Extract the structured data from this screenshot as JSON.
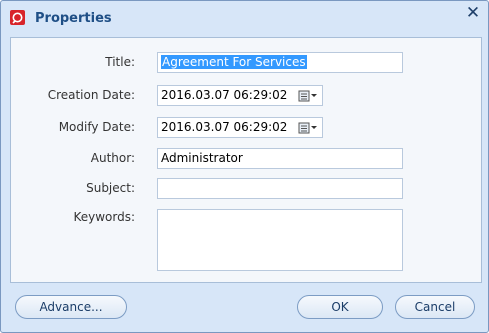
{
  "window": {
    "title": "Properties",
    "close_glyph": "✕"
  },
  "fields": {
    "title": {
      "label": "Title:",
      "value": "Agreement For Services"
    },
    "creation_date": {
      "label": "Creation Date:",
      "value": "2016.03.07 06:29:02"
    },
    "modify_date": {
      "label": "Modify Date:",
      "value": "2016.03.07 06:29:02"
    },
    "author": {
      "label": "Author:",
      "value": "Administrator"
    },
    "subject": {
      "label": "Subject:",
      "value": ""
    },
    "keywords": {
      "label": "Keywords:",
      "value": ""
    }
  },
  "buttons": {
    "advance": "Advance...",
    "ok": "OK",
    "cancel": "Cancel"
  }
}
